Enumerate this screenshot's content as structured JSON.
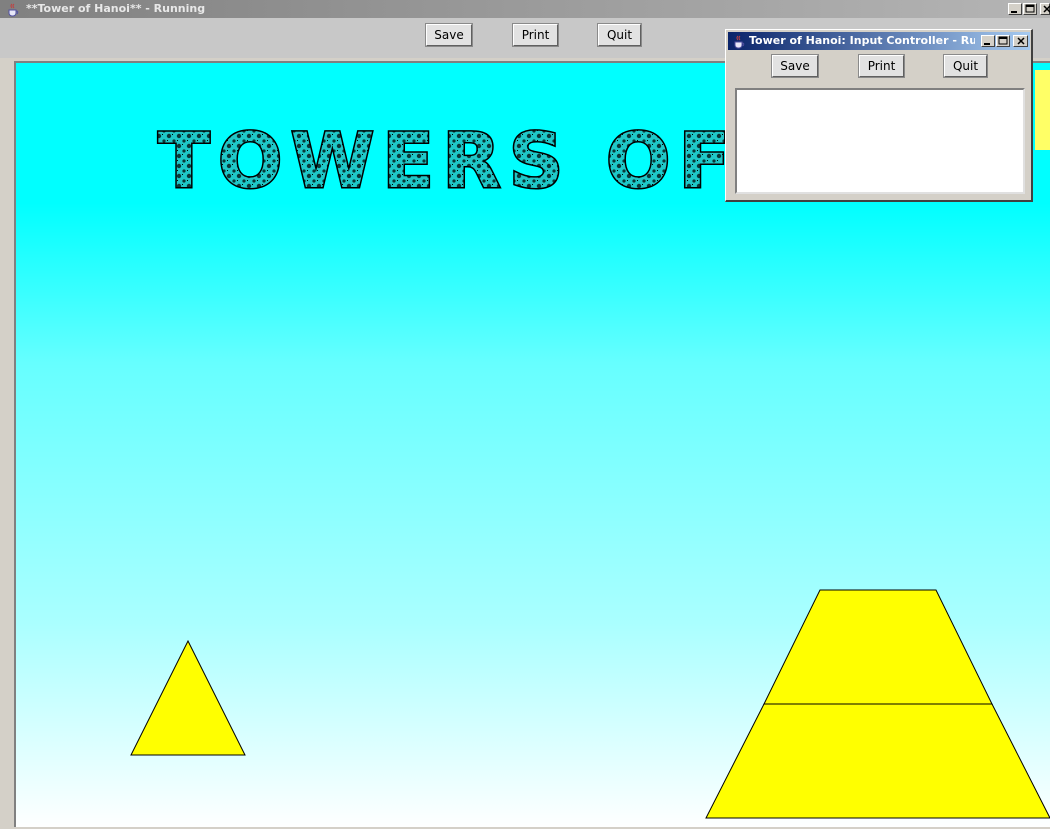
{
  "main_window": {
    "title": "**Tower of Hanoi** - Running",
    "toolbar": {
      "save_label": "Save",
      "print_label": "Print",
      "quit_label": "Quit"
    },
    "canvas": {
      "banner_text": "TOWERS OF H",
      "colors": {
        "sky_top": "#00ffff",
        "sky_bottom": "#ffffff",
        "piece_fill": "#ffff00",
        "banner_fill": "#1fc8c8"
      }
    }
  },
  "controller_window": {
    "title": "Tower of Hanoi: Input Controller - Run...",
    "toolbar": {
      "save_label": "Save",
      "print_label": "Print",
      "quit_label": "Quit"
    },
    "log_text": ""
  },
  "icons": {
    "app": "java-cup-icon",
    "minimize": "minimize-icon",
    "maximize": "maximize-icon",
    "close": "close-icon"
  }
}
